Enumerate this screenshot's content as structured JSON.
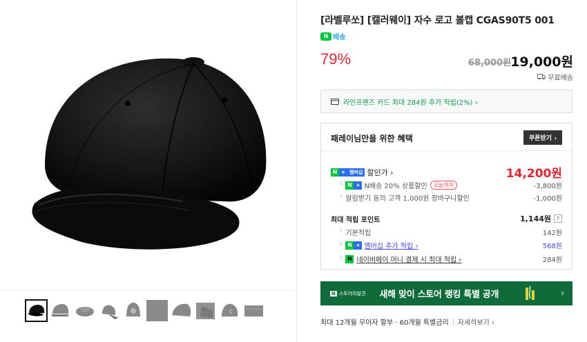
{
  "product": {
    "title": "[라벨루쏘] [캘러웨이] 자수 로고 볼캡 CGAS90T5 001",
    "delivery_badge": "N",
    "delivery_label": "배송",
    "discount_rate": "79%",
    "original_price": "68,000원",
    "sale_price": "19,000원",
    "shipping": "무료배송"
  },
  "card_offer": {
    "label": "라인프렌즈 카드 최대 284원 추가 적립(2%) ›"
  },
  "benefit": {
    "title": "패레이님만을 위한 혜택",
    "coupon_button": "쿠폰받기",
    "discount_price": {
      "badge_n": "N",
      "badge_plus": "+",
      "badge_member": "멤버십",
      "label": "할인가 ›",
      "value": "14,200원"
    },
    "discount_items": [
      {
        "label": "N배송 20% 상품할인",
        "badge": "오늘까지",
        "value": "-3,800원"
      },
      {
        "label": "알림받기 동의 고객 1,000원 장바구니할인",
        "value": "-1,000원"
      }
    ],
    "points": {
      "label": "최대 적립 포인트",
      "value": "1,144원",
      "help": "?"
    },
    "point_items": [
      {
        "label": "기본적립",
        "value": "142원"
      },
      {
        "label": "멤버십 추가 적립 ›",
        "value": "568원"
      },
      {
        "label": "네이버페이 머니 결제 시 최대 적립 ›",
        "value": "284원"
      }
    ]
  },
  "banner": {
    "logo_mark": "N",
    "logo_text": "스토어의발견",
    "headline": "새해 맞이 스토어 랭킹 특별 공개"
  },
  "installment": {
    "text": "최대 12개월 무이자 할부 · 60개월 특별금리",
    "more": "자세히보기 ›"
  },
  "icons": {
    "card": "card-icon",
    "truck": "truck-icon",
    "chevron": "chevron-right-icon"
  },
  "colors": {
    "discount_red": "#e62431",
    "naver_green": "#00c73c",
    "point_blue": "#4a4ae8",
    "banner_green": "#0f6b3a"
  }
}
